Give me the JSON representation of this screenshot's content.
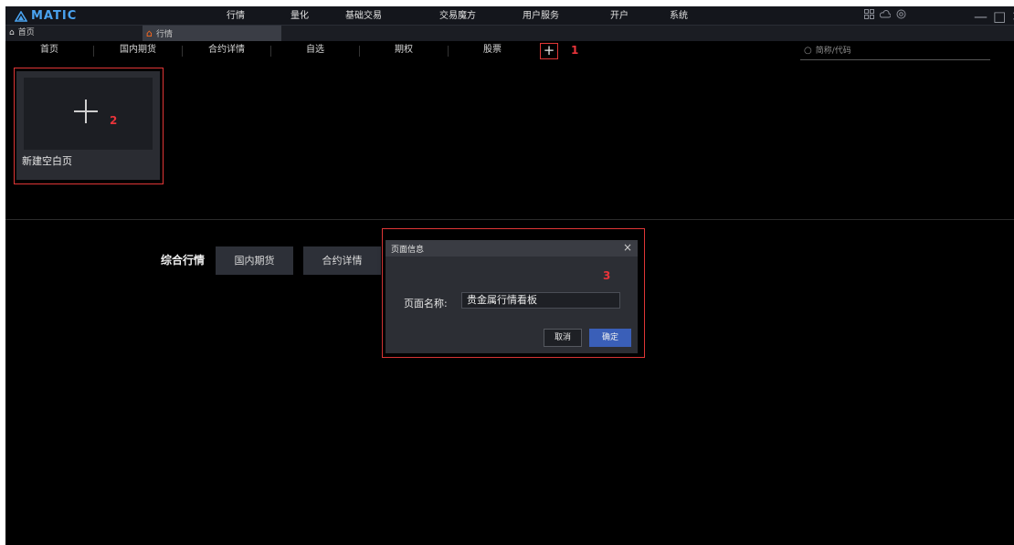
{
  "app": {
    "logo_text": "MATIC"
  },
  "menu": [
    {
      "id": "market",
      "label": "行情"
    },
    {
      "id": "quant",
      "label": "量化"
    },
    {
      "id": "trade",
      "label": "基础交易"
    },
    {
      "id": "magic",
      "label": "交易魔方"
    },
    {
      "id": "user",
      "label": "用户服务"
    },
    {
      "id": "open",
      "label": "开户"
    },
    {
      "id": "system",
      "label": "系统"
    }
  ],
  "system_icons": [
    "apps-icon",
    "cloud-icon",
    "settings-icon"
  ],
  "window_controls": {
    "minimize": "—",
    "maximize": "□",
    "close": "✕"
  },
  "tabs": {
    "home": "首页",
    "active": "行情"
  },
  "subnav": [
    {
      "label": "首页"
    },
    {
      "label": "国内期货"
    },
    {
      "label": "合约详情"
    },
    {
      "label": "自选"
    },
    {
      "label": "期权"
    },
    {
      "label": "股票"
    }
  ],
  "add_tab": "+",
  "markers": {
    "m1": "1",
    "m2": "2",
    "m3": "3"
  },
  "search": {
    "placeholder": "简称/代码"
  },
  "template_card": {
    "label": "新建空白页"
  },
  "page_section": {
    "title": "综合行情",
    "buttons": [
      "国内期货",
      "合约详情"
    ]
  },
  "dialog": {
    "title": "页面信息",
    "close": "×",
    "field_label": "页面名称:",
    "field_value": "贵金属行情看板",
    "cancel": "取消",
    "confirm": "确定"
  },
  "colors": {
    "accent_red": "#e03636",
    "confirm_blue": "#3a5fb8",
    "logo_blue": "#4aa3f0"
  }
}
